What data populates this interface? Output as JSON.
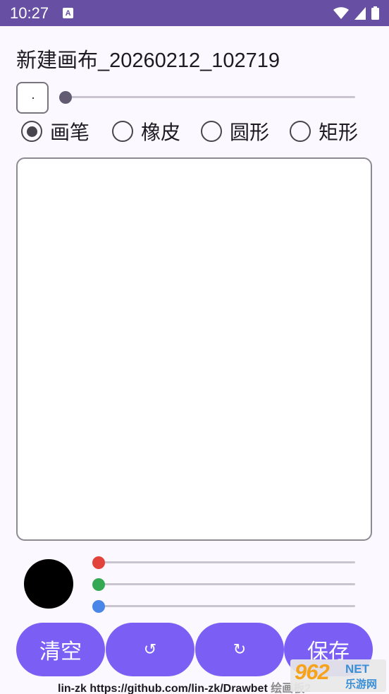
{
  "status_bar": {
    "time": "10:27",
    "notification_icon": "A",
    "icons": [
      "wifi-icon",
      "signal-icon",
      "battery-icon"
    ]
  },
  "title": "新建画布_20260212_102719",
  "brush_size": {
    "preview": "·",
    "level": 0.0
  },
  "tools": [
    {
      "label": "画笔",
      "selected": true
    },
    {
      "label": "橡皮",
      "selected": false
    },
    {
      "label": "圆形",
      "selected": false
    },
    {
      "label": "矩形",
      "selected": false
    }
  ],
  "color": {
    "current": "#000000",
    "red": 0,
    "green": 0,
    "blue": 0,
    "red_thumb_color": "#e2433a",
    "green_thumb_color": "#34a853",
    "blue_thumb_color": "#4a86e8"
  },
  "buttons": {
    "clear": "清空",
    "undo": "↺",
    "redo": "↻",
    "save": "保存"
  },
  "footer": {
    "text": "lin-zk https://github.com/lin-zk/Drawbet",
    "tail": "绘画板2"
  },
  "watermark": {
    "number": "962",
    "net": "NET",
    "site": "乐游网"
  },
  "colors": {
    "accent": "#6750a4",
    "button": "#7b5ff5"
  }
}
